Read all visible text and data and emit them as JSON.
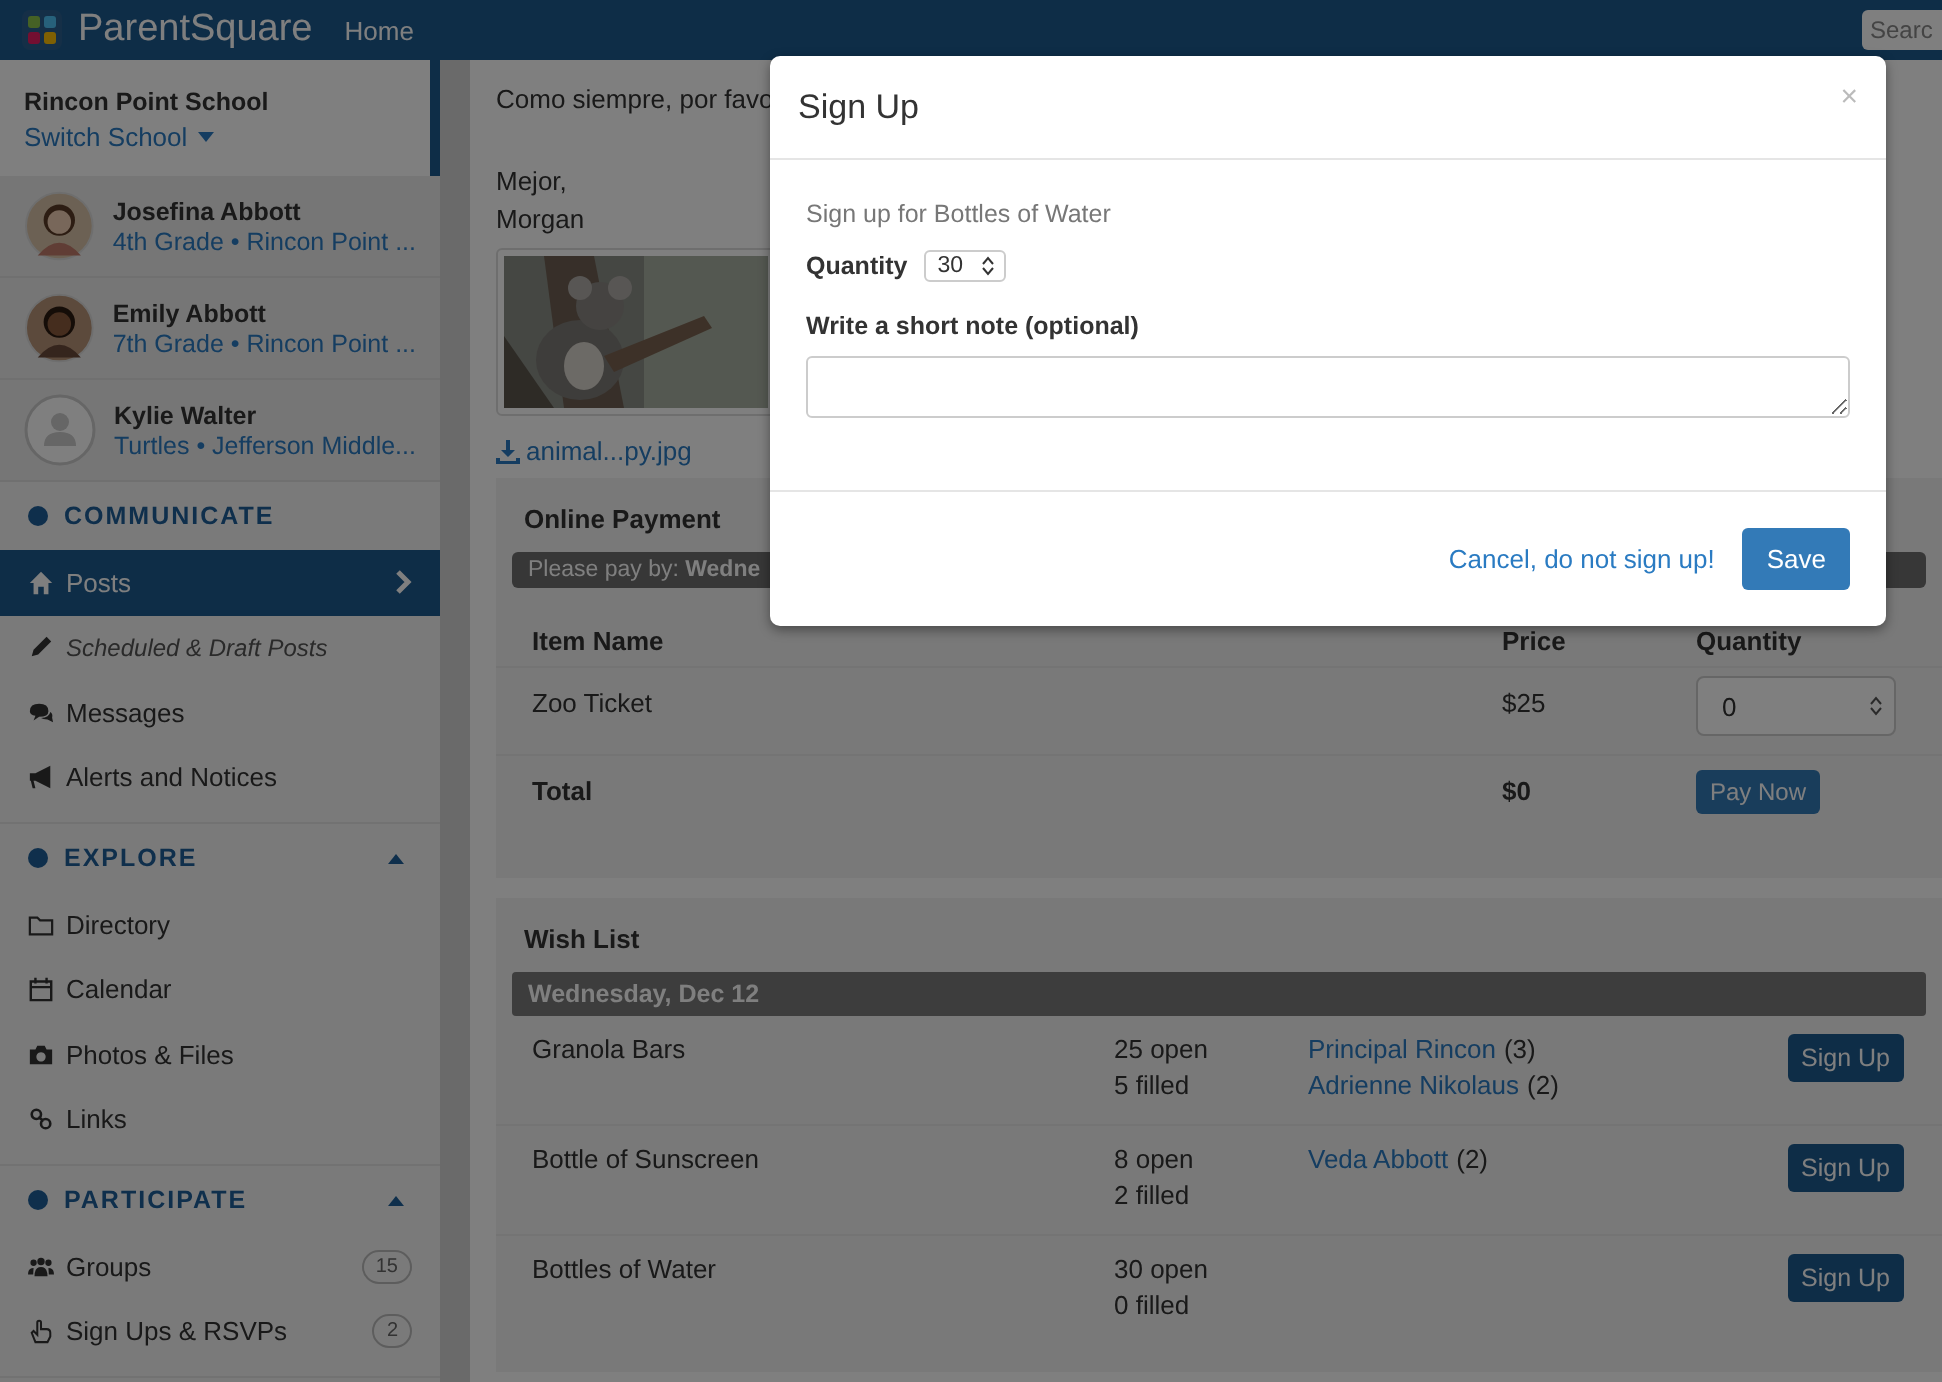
{
  "topbar": {
    "brand": "ParentSquare",
    "nav": "Home",
    "search": {
      "placeholder": "Searc"
    }
  },
  "sidebar": {
    "school": "Rincon Point School",
    "switch": "Switch School",
    "students": [
      {
        "name": "Josefina Abbott",
        "detail": "4th Grade • Rincon Point ..."
      },
      {
        "name": "Emily Abbott",
        "detail": "7th Grade • Rincon Point ..."
      },
      {
        "name": "Kylie Walter",
        "detail": "Turtles • Jefferson Middle...",
        "kind": "placeholder"
      }
    ],
    "sections": [
      {
        "title": "COMMUNICATE",
        "items": [
          {
            "label": "Posts",
            "selected": true,
            "kind": "main"
          },
          {
            "label": "Scheduled & Draft Posts",
            "selected": false,
            "kind": "sub"
          },
          {
            "label": "Messages",
            "selected": false,
            "kind": "main"
          },
          {
            "label": "Alerts and Notices",
            "selected": false,
            "kind": "main"
          }
        ]
      },
      {
        "title": "EXPLORE",
        "expanded": true,
        "items": [
          {
            "label": "Directory",
            "selected": false,
            "kind": "main"
          },
          {
            "label": "Calendar",
            "selected": false,
            "kind": "main"
          },
          {
            "label": "Photos & Files",
            "selected": false,
            "kind": "main"
          },
          {
            "label": "Links",
            "selected": false,
            "kind": "main"
          }
        ]
      },
      {
        "title": "PARTICIPATE",
        "expanded": true,
        "items": [
          {
            "label": "Groups",
            "selected": false,
            "kind": "main",
            "count": "15"
          },
          {
            "label": "Sign Ups & RSVPs",
            "selected": false,
            "kind": "main",
            "count": "2"
          }
        ]
      }
    ]
  },
  "post": {
    "lines": [
      "Como siempre, por favo"
    ],
    "closing": [
      "Mejor,",
      "Morgan"
    ],
    "attachment": {
      "kind": "picture"
    },
    "file": "animal...py.jpg"
  },
  "payment": {
    "title": "Online Payment",
    "notice": "Please pay by: **Wedne**",
    "columns": [
      "Item Name",
      "Price",
      "Quantity"
    ],
    "items": [
      {
        "name": "Zoo Ticket",
        "price": "$25",
        "quantity": "0"
      }
    ],
    "total": {
      "label": "Total",
      "amount": "$0",
      "button": "Pay Now"
    }
  },
  "wishlist": {
    "title": "Wish List",
    "date": "Wednesday, Dec 12",
    "rows": [
      {
        "item": "Granola Bars",
        "open": "25 open",
        "filled": "5 filled",
        "signups": [
          {
            "name": "Principal Rincon",
            "count": "(3)"
          },
          {
            "name": "Adrienne Nikolaus",
            "count": "(2)"
          }
        ],
        "button": "Sign Up"
      },
      {
        "item": "Bottle of Sunscreen",
        "open": "8 open",
        "filled": "2 filled",
        "signups": [
          {
            "name": "Veda Abbott",
            "count": "(2)"
          }
        ],
        "button": "Sign Up"
      },
      {
        "item": "Bottles of Water",
        "open": "30 open",
        "filled": "0 filled",
        "signups": [],
        "button": "Sign Up"
      }
    ]
  },
  "modal": {
    "title": "Sign Up",
    "close": "×",
    "subtitle": "Sign up for Bottles of Water",
    "quantity_label": "Quantity",
    "quantity": "30",
    "note_label": "Write a short note (optional)",
    "cancel": "Cancel, do not sign up!",
    "save": "Save"
  }
}
